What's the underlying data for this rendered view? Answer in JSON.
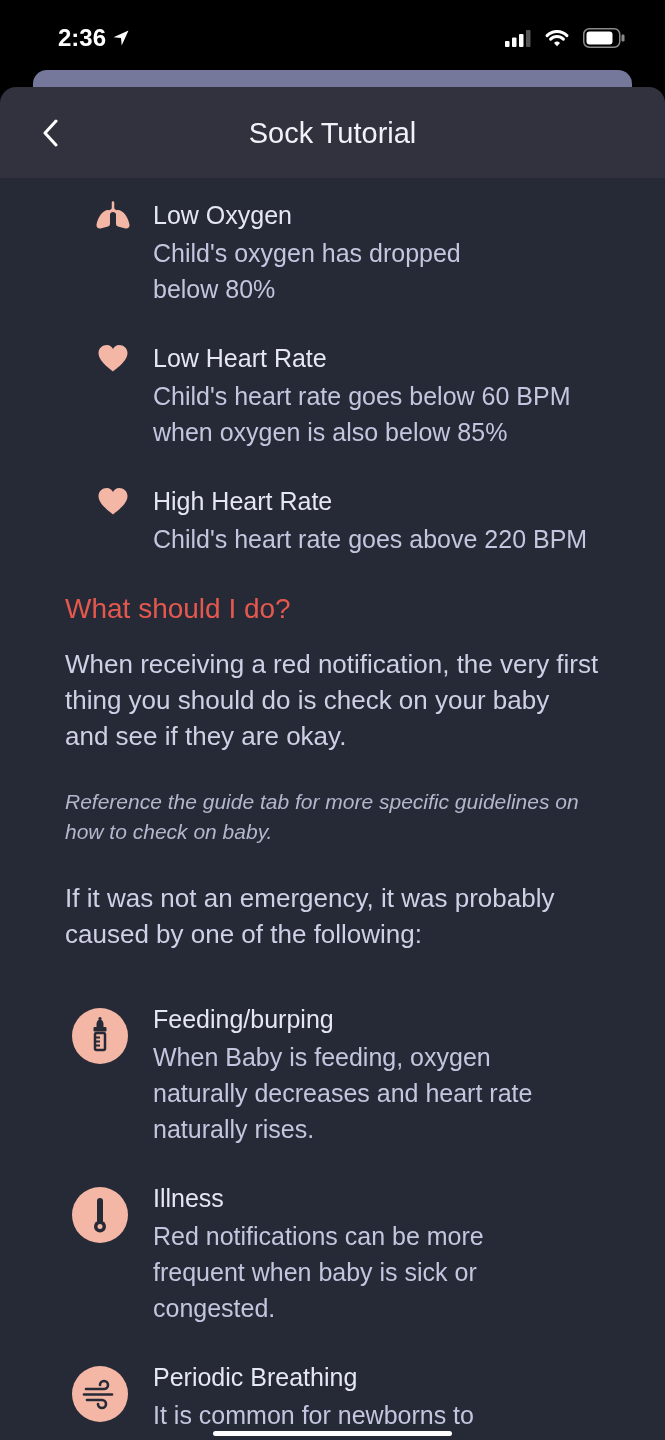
{
  "status_bar": {
    "time": "2:36"
  },
  "header": {
    "title": "Sock Tutorial"
  },
  "alerts": [
    {
      "kind": "oxygen",
      "title": "Low Oxygen",
      "description": "Child's oxygen has dropped\nbelow 80%"
    },
    {
      "kind": "heart",
      "title": "Low Heart Rate",
      "description": "Child's heart rate goes below 60 BPM\nwhen oxygen is also below 85%"
    },
    {
      "kind": "heart",
      "title": "High Heart Rate",
      "description": "Child's heart rate goes above 220 BPM"
    }
  ],
  "guidance": {
    "heading": "What should I do?",
    "paragraphs": [
      {
        "kind": "body",
        "text": "When receiving a red notification, the very first\nthing you should do is check on your baby\nand see if they are okay."
      },
      {
        "kind": "note",
        "text": "Reference the guide tab for more specific guidelines on\nhow to check on baby."
      },
      {
        "kind": "body",
        "text": "If it was not an emergency, it was probably\ncaused by one of the following:"
      }
    ]
  },
  "causes": [
    {
      "kind": "feeding",
      "title": "Feeding/burping",
      "description": "When Baby is feeding, oxygen\nnaturally decreases and heart rate\nnaturally rises."
    },
    {
      "kind": "illness",
      "title": "Illness",
      "description": "Red notifications can be more\nfrequent when baby is sick or\ncongested."
    },
    {
      "kind": "breathing",
      "title": "Periodic Breathing",
      "description": "It is common for newborns to"
    }
  ]
}
